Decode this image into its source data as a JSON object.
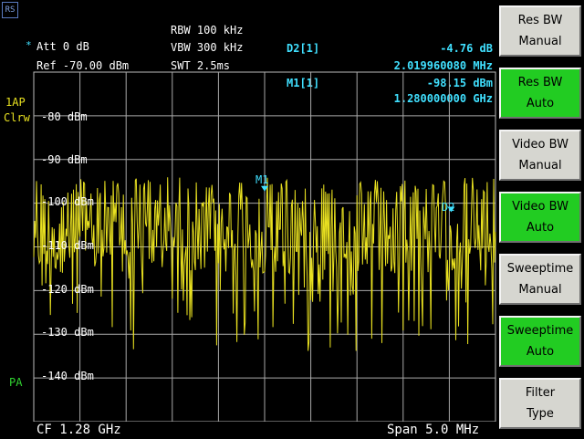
{
  "header": {
    "logo_text": "RS",
    "att_marker": "*",
    "att": "Att  0 dB",
    "ref": "Ref  -70.00 dBm",
    "rbw": "RBW 100 kHz",
    "vbw": "VBW 300 kHz",
    "swt": "SWT 2.5ms"
  },
  "markers": {
    "d2": {
      "name": "D2[1]",
      "level": "-4.76 dB",
      "freq": "2.019960080 MHz"
    },
    "m1": {
      "name": "M1[1]",
      "level": "-98.15 dBm",
      "freq": "1.280000000 GHz"
    }
  },
  "side_labels": {
    "trace_mode": "1AP",
    "trace_detector": "Clrw",
    "preamp": "PA"
  },
  "marker_tags": {
    "m1": "M1",
    "d2": "D2"
  },
  "y_axis": {
    "labels": [
      "-80 dBm",
      "-90 dBm",
      "-100 dBm",
      "-110 dBm",
      "-120 dBm",
      "-130 dBm",
      "-140 dBm"
    ]
  },
  "footer": {
    "center": "CF 1.28 GHz",
    "span": "Span 5.0 MHz"
  },
  "softkeys": [
    {
      "line1": "Res BW",
      "line2": "Manual",
      "active": false
    },
    {
      "line1": "Res BW",
      "line2": "Auto",
      "active": true
    },
    {
      "line1": "Video BW",
      "line2": "Manual",
      "active": false
    },
    {
      "line1": "Video BW",
      "line2": "Auto",
      "active": true
    },
    {
      "line1": "Sweeptime",
      "line2": "Manual",
      "active": false
    },
    {
      "line1": "Sweeptime",
      "line2": "Auto",
      "active": true
    },
    {
      "line1": "Filter",
      "line2": "Type",
      "active": false
    }
  ],
  "chart_data": {
    "type": "line",
    "ylim": [
      -150,
      -70
    ],
    "xlim": [
      1277.5,
      1282.5
    ],
    "x_unit": "MHz",
    "grid": true,
    "trace_color": "#e8e020",
    "grid_color": "#a8a8a8",
    "noise_floor_dbm": -108,
    "peak_level_dbm": -98,
    "min_level_dbm": -134,
    "marker_m1": {
      "x": 1280.0,
      "y": -98.15
    },
    "marker_d2": {
      "x": 1282.02,
      "y": -102.91
    }
  }
}
